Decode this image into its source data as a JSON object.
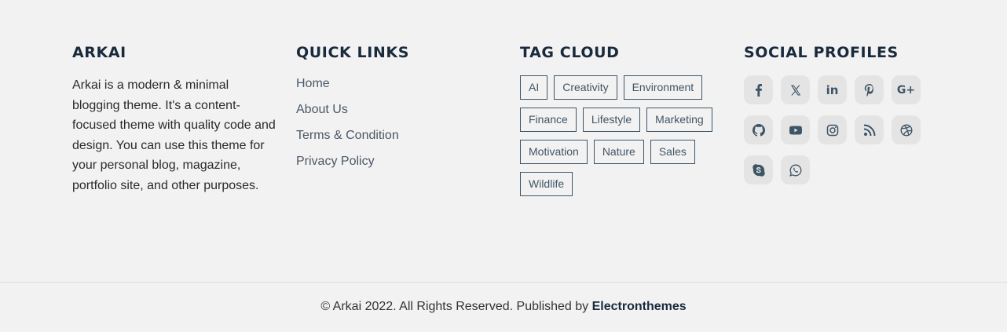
{
  "about": {
    "heading": "ARKAI",
    "text": "Arkai is a modern & minimal blogging theme. It's a content-focused theme with quality code and design. You can use this theme for your personal blog, magazine, portfolio site, and other purposes."
  },
  "quick_links": {
    "heading": "QUICK LINKS",
    "items": [
      "Home",
      "About Us",
      "Terms & Condition",
      "Privacy Policy"
    ]
  },
  "tag_cloud": {
    "heading": "TAG CLOUD",
    "tags": [
      "AI",
      "Creativity",
      "Environment",
      "Finance",
      "Lifestyle",
      "Marketing",
      "Motivation",
      "Nature",
      "Sales",
      "Wildlife"
    ]
  },
  "social": {
    "heading": "SOCIAL PROFILES",
    "icons": [
      "facebook-icon",
      "x-icon",
      "linkedin-icon",
      "pinterest-icon",
      "google-plus-icon",
      "github-icon",
      "youtube-icon",
      "instagram-icon",
      "rss-icon",
      "dribbble-icon",
      "skype-icon",
      "whatsapp-icon"
    ],
    "linkedin_text": "in",
    "google_plus_text": "G+"
  },
  "copyright": {
    "text": "© Arkai 2022. All Rights Reserved. Published by ",
    "publisher": "Electronthemes"
  },
  "colors": {
    "background": "#f3f2f2",
    "heading": "#1a2a3d",
    "accent": "#3e5566"
  }
}
